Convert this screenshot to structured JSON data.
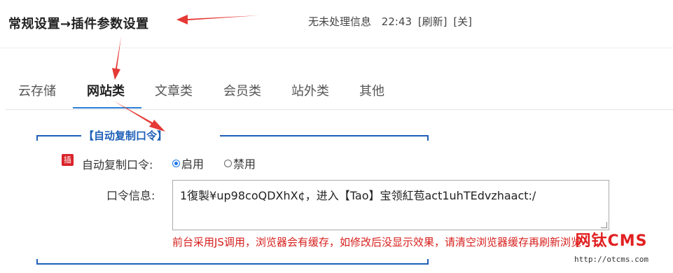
{
  "header": {
    "title": "常规设置→插件参数设置",
    "status_message": "无未处理信息",
    "time": "22:43",
    "refresh_label": "[刷新]",
    "close_label": "[关]"
  },
  "tabs": [
    {
      "label": "云存储",
      "active": false
    },
    {
      "label": "网站类",
      "active": true
    },
    {
      "label": "文章类",
      "active": false
    },
    {
      "label": "会员类",
      "active": false
    },
    {
      "label": "站外类",
      "active": false
    },
    {
      "label": "其他",
      "active": false
    }
  ],
  "section": {
    "legend": "【自动复制口令】",
    "plugin_badge": "插",
    "auto_copy_label": "自动复制口令:",
    "radio_enable": "启用",
    "radio_disable": "禁用",
    "selected": "启用",
    "password_info_label": "口令信息:",
    "password_info_value": "1復製¥up98coQDXhX¢，进入【Tao】宝领紅苞act1uhTEdvzhaact:/",
    "hint": "前台采用JS调用，浏览器会有缓存，如修改后没显示效果，请清空浏览器缓存再刷新浏览"
  },
  "watermark": {
    "logo": "网钛CMS",
    "url": "http://otcms.com"
  },
  "colors": {
    "accent": "#1f60b8",
    "annotation_arrow": "#e53935",
    "hint_red": "#d7201e"
  }
}
